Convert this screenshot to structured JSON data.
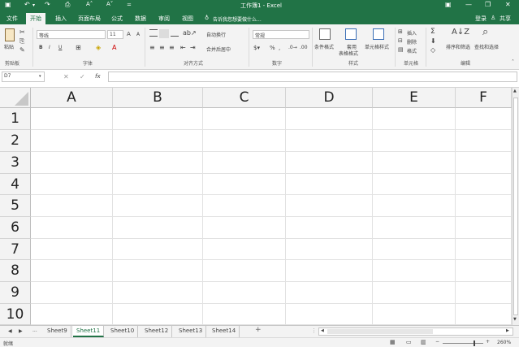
{
  "window": {
    "title": "工作簿1 - Excel",
    "qat_more": "="
  },
  "tabs": [
    {
      "label": "文件"
    },
    {
      "label": "开始"
    },
    {
      "label": "插入"
    },
    {
      "label": "页面布局"
    },
    {
      "label": "公式"
    },
    {
      "label": "数据"
    },
    {
      "label": "审阅"
    },
    {
      "label": "视图"
    }
  ],
  "tell_me": "告诉我您想要做什么...",
  "account": {
    "login": "登录",
    "share": "共享"
  },
  "ribbon": {
    "clipboard": {
      "paste": "粘贴",
      "group": "剪贴板"
    },
    "font": {
      "name": "等线",
      "size": "11",
      "bold": "B",
      "italic": "I",
      "underline": "U",
      "grow": "A",
      "shrink": "A",
      "group": "字体"
    },
    "alignment": {
      "wrap": "自动换行",
      "merge": "合并后居中",
      "group": "对齐方式"
    },
    "number": {
      "format": "常规",
      "percent": "%",
      "group": "数字"
    },
    "styles": {
      "conditional": "条件格式",
      "table": "套用",
      "table2": "表格格式",
      "cell": "单元格样式",
      "group": "样式"
    },
    "cells": {
      "insert": "插入",
      "delete": "删除",
      "format": "格式",
      "group": "单元格"
    },
    "editing": {
      "sort": "排序和筛选",
      "find": "查找和选择",
      "group": "编辑"
    }
  },
  "formula_bar": {
    "name_box": "D7",
    "fx": "fx",
    "value": ""
  },
  "columns": [
    "A",
    "B",
    "C",
    "D",
    "E",
    "F"
  ],
  "rows": [
    "1",
    "2",
    "3",
    "4",
    "5",
    "6",
    "7",
    "8",
    "9",
    "10"
  ],
  "sheets": {
    "ellipsis": "...",
    "tabs": [
      "Sheet9",
      "Sheet11",
      "Sheet10",
      "Sheet12",
      "Sheet13",
      "Sheet14"
    ],
    "active": "Sheet11",
    "add": "+"
  },
  "status": {
    "ready": "就绪",
    "zoom": "260%"
  },
  "colors": {
    "accent": "#217346",
    "ribbon_bg": "#f3f3f3",
    "grid_line": "#e2e2e2"
  }
}
